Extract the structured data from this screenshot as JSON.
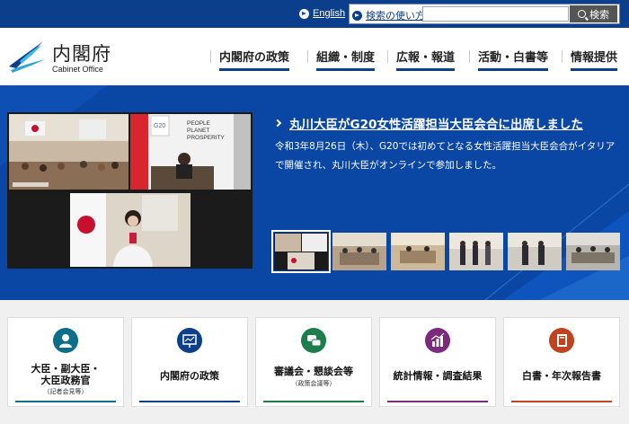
{
  "topbar": {
    "english_label": "English",
    "howto_label": "検索の使い方",
    "search_placeholder": "",
    "search_button": "検索"
  },
  "header": {
    "logo_ja": "内閣府",
    "logo_en": "Cabinet Office",
    "nav": [
      {
        "label": "内閣府の政策"
      },
      {
        "label": "組織・制度"
      },
      {
        "label": "広報・報道"
      },
      {
        "label": "活動・白書等"
      },
      {
        "label": "情報提供"
      }
    ]
  },
  "hero": {
    "headline": "丸川大臣がG20女性活躍担当大臣会合に出席しました",
    "description": "令和3年8月26日（木）、G20では初めてとなる女性活躍担当大臣会合がイタリアで開催され、丸川大臣がオンラインで参加しました。",
    "slide_text": {
      "people": "PEOPLE",
      "planet": "PLANET",
      "prosperity": "PROSPERITY",
      "g20": "G20"
    }
  },
  "cards": [
    {
      "label_lines": [
        "大臣・副大臣・",
        "大臣政務官"
      ],
      "sub": "（記者会見等）",
      "icon": "person-icon",
      "color": "#0d6e8a"
    },
    {
      "label_lines": [
        "内閣府の政策"
      ],
      "sub": "",
      "icon": "presentation-icon",
      "color": "#0b3f8c"
    },
    {
      "label_lines": [
        "審議会・懇談会等"
      ],
      "sub": "（政策会議等）",
      "icon": "chat-icon",
      "color": "#1d7d4b"
    },
    {
      "label_lines": [
        "統計情報・調査結果"
      ],
      "sub": "",
      "icon": "bar-chart-icon",
      "color": "#7b2a7d"
    },
    {
      "label_lines": [
        "白書・年次報告書"
      ],
      "sub": "",
      "icon": "book-icon",
      "color": "#c0421f"
    }
  ]
}
